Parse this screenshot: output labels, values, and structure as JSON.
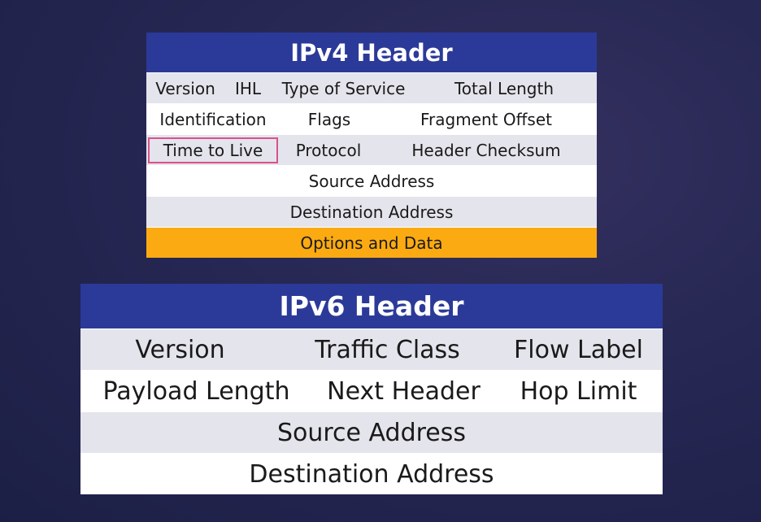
{
  "ipv4": {
    "title": "IPv4 Header",
    "rows": [
      [
        "Version",
        "IHL",
        "Type of Service",
        "Total Length"
      ],
      [
        "Identification",
        "Flags",
        "Fragment Offset"
      ],
      [
        "Time to Live",
        "Protocol",
        "Header Checksum"
      ],
      [
        "Source Address"
      ],
      [
        "Destination Address"
      ],
      [
        "Options and Data"
      ]
    ],
    "highlighted_field": "Time to Live",
    "highlight_color": "#d8528d",
    "options_row_color": "#fbab11"
  },
  "ipv6": {
    "title": "IPv6 Header",
    "rows": [
      [
        "Version",
        "Traffic Class",
        "Flow Label"
      ],
      [
        "Payload Length",
        "Next Header",
        "Hop Limit"
      ],
      [
        "Source Address"
      ],
      [
        "Destination Address"
      ]
    ]
  },
  "colors": {
    "header_bar": "#2b3a99",
    "row_shade": "#e4e4ec",
    "row_white": "#ffffff"
  }
}
